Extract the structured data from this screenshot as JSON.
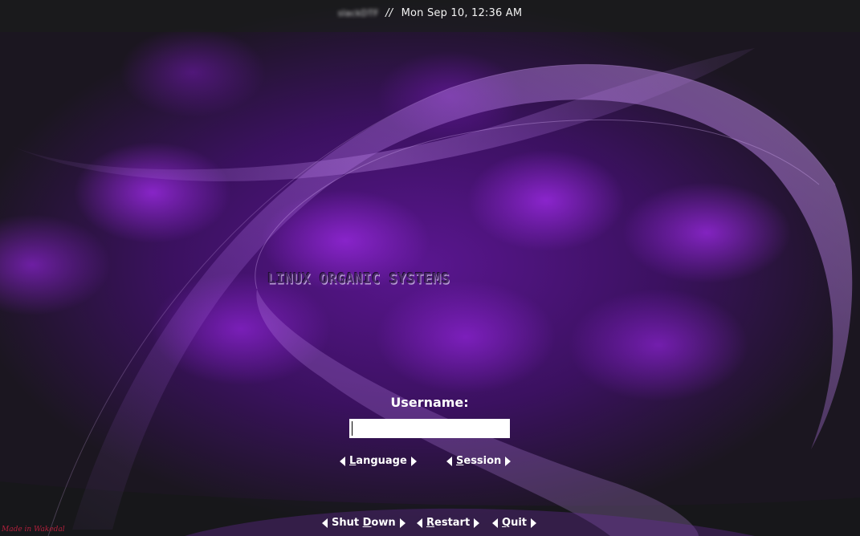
{
  "top_bar": {
    "hostname": "slackDTF",
    "separator": "//",
    "datetime": "Mon Sep 10, 12:36 AM"
  },
  "branding": {
    "logo_text": "LINUX ORGANIC SYSTEMS"
  },
  "login": {
    "username_label": "Username:",
    "username_value": ""
  },
  "options": {
    "language": {
      "underlined": "L",
      "rest": "anguage"
    },
    "session": {
      "underlined": "S",
      "rest": "ession"
    }
  },
  "footer": {
    "shutdown": {
      "before": "Shut ",
      "underlined": "D",
      "after": "own"
    },
    "restart": {
      "underlined": "R",
      "rest": "estart"
    },
    "quit": {
      "underlined": "Q",
      "rest": "uit"
    },
    "credit": "Made in Wakedal"
  },
  "colors": {
    "background_purple": "#5a1690",
    "text": "#ffffff",
    "credit": "#b0203c"
  }
}
